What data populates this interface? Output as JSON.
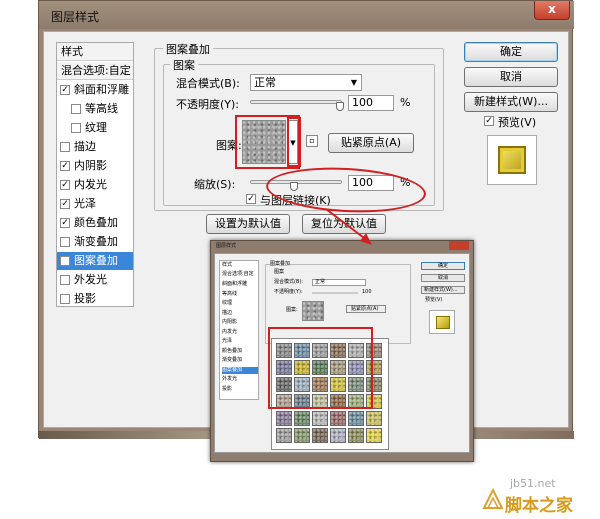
{
  "dialog": {
    "title": "图层样式",
    "close_label": "x"
  },
  "style_list": {
    "header": "样式",
    "blend_options": "混合选项:自定",
    "items": [
      {
        "label": "斜面和浮雕",
        "checked": true,
        "indent": false
      },
      {
        "label": "等高线",
        "checked": false,
        "indent": true
      },
      {
        "label": "纹理",
        "checked": false,
        "indent": true
      },
      {
        "label": "描边",
        "checked": false,
        "indent": false
      },
      {
        "label": "内阴影",
        "checked": true,
        "indent": false
      },
      {
        "label": "内发光",
        "checked": true,
        "indent": false
      },
      {
        "label": "光泽",
        "checked": true,
        "indent": false
      },
      {
        "label": "颜色叠加",
        "checked": true,
        "indent": false
      },
      {
        "label": "渐变叠加",
        "checked": false,
        "indent": false
      },
      {
        "label": "图案叠加",
        "checked": true,
        "indent": false,
        "selected": true
      },
      {
        "label": "外发光",
        "checked": false,
        "indent": false
      },
      {
        "label": "投影",
        "checked": false,
        "indent": false
      }
    ]
  },
  "pattern_overlay": {
    "group_title": "图案叠加",
    "sub_title": "图案",
    "blend_mode_label": "混合模式(B):",
    "blend_mode_value": "正常",
    "opacity_label": "不透明度(Y):",
    "opacity_value": "100",
    "opacity_unit": "%",
    "opacity_level": 1.0,
    "pattern_label": "图案:",
    "snap_button": "贴紧原点(A)",
    "scale_label": "缩放(S):",
    "scale_value": "100",
    "scale_unit": "%",
    "link_label": "与图层链接(K)",
    "link_checked": true,
    "set_default": "设置为默认值",
    "reset_default": "复位为默认值"
  },
  "right_panel": {
    "ok": "确定",
    "cancel": "取消",
    "new_style": "新建样式(W)...",
    "preview_label": "预览(V)",
    "preview_checked": true
  },
  "inset": {
    "title": "图层样式",
    "header": "样式",
    "blend_options": "混合选项:自定",
    "items": [
      "斜面和浮雕",
      "等高线",
      "纹理",
      "描边",
      "内阴影",
      "内发光",
      "光泽",
      "颜色叠加",
      "渐变叠加",
      "图案叠加",
      "外发光",
      "投影"
    ],
    "group_title": "图案叠加",
    "sub_title": "图案",
    "blend_mode_label": "混合模式(B):",
    "blend_mode_value": "正常",
    "opacity_label": "不透明度(Y):",
    "opacity_value": "100",
    "pattern_label": "图案:",
    "snap_button": "贴紧原点(A)",
    "ok": "确定",
    "cancel": "取消",
    "new_style": "新建样式(W)...",
    "preview_label": "预览(V)",
    "swatch_colors": [
      "#8a8a8a",
      "#6f8fa8",
      "#a0a0a0",
      "#8b6f5a",
      "#b0b0b0",
      "#9a8a7a",
      "#7a7a9a",
      "#c8b43a",
      "#5f7f5f",
      "#a89a80",
      "#8f8fb0",
      "#b5a060",
      "#6a6a6a",
      "#9fb0c0",
      "#a07a5a",
      "#d0c040",
      "#7f8f7f",
      "#8a8a6a",
      "#b0a090",
      "#708090",
      "#c0c0a0",
      "#906a4a",
      "#a0b080",
      "#d8c850",
      "#8a7a9a",
      "#6a8a6a",
      "#b8b8b8",
      "#9a6a6a",
      "#7090a0",
      "#c8c060",
      "#a0a0a0",
      "#8a9a70",
      "#7a6a5a",
      "#b0b0c0",
      "#909060",
      "#e0d050"
    ]
  },
  "watermark": {
    "site": "jb51.net",
    "name": "脚本之家"
  }
}
